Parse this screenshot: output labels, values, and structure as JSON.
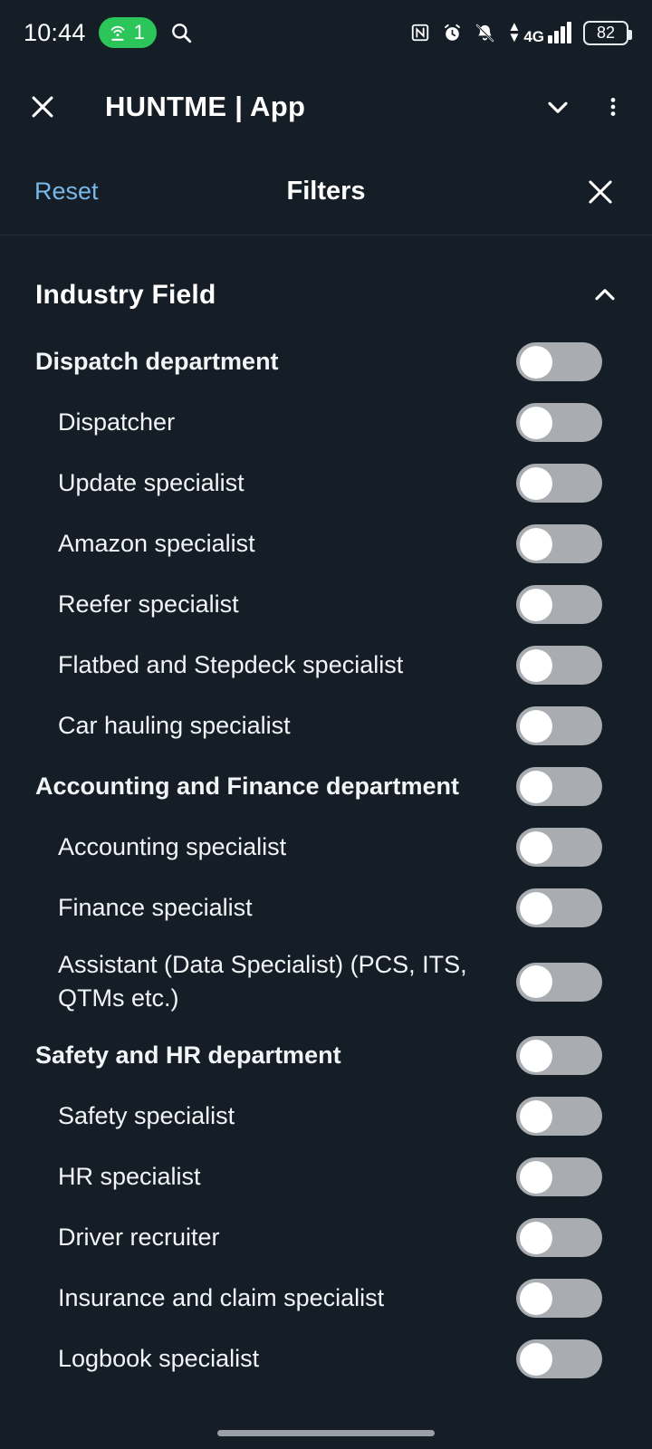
{
  "statusbar": {
    "time": "10:44",
    "hotspot_count": "1",
    "battery_percent": "82",
    "network_label": "4G",
    "icons": [
      "search-icon",
      "nfc-icon",
      "alarm-icon",
      "notifications-muted-icon",
      "signal-icon",
      "battery-icon"
    ]
  },
  "appbar": {
    "title": "HUNTME | App",
    "close_label": "close-icon",
    "expand_label": "chevron-down-icon",
    "overflow_label": "more-vertical-icon"
  },
  "filterbar": {
    "reset_label": "Reset",
    "title": "Filters",
    "close_label": "close-icon"
  },
  "section": {
    "title": "Industry Field",
    "expanded": true,
    "collapse_icon": "chevron-up-icon"
  },
  "colors": {
    "background": "#151d26",
    "accent_link": "#79b8e8",
    "toggle_off_track": "#a9adb1",
    "toggle_knob": "#ffffff",
    "hotspot_green": "#2bc55a",
    "text_primary": "#f2f5f7"
  },
  "rows": [
    {
      "label": "Dispatch department",
      "type": "dept",
      "on": false
    },
    {
      "label": "Dispatcher",
      "type": "child",
      "on": false
    },
    {
      "label": "Update specialist",
      "type": "child",
      "on": false
    },
    {
      "label": "Amazon specialist",
      "type": "child",
      "on": false
    },
    {
      "label": "Reefer specialist",
      "type": "child",
      "on": false
    },
    {
      "label": "Flatbed and Stepdeck specialist",
      "type": "child",
      "on": false
    },
    {
      "label": "Car hauling specialist",
      "type": "child",
      "on": false
    },
    {
      "label": "Accounting and Finance department",
      "type": "dept",
      "on": false
    },
    {
      "label": "Accounting specialist",
      "type": "child",
      "on": false
    },
    {
      "label": "Finance specialist",
      "type": "child",
      "on": false
    },
    {
      "label": "Assistant (Data Specialist) (PCS, ITS, QTMs etc.)",
      "type": "child",
      "on": false,
      "tall": true
    },
    {
      "label": "Safety and HR department",
      "type": "dept",
      "on": false
    },
    {
      "label": "Safety specialist",
      "type": "child",
      "on": false
    },
    {
      "label": "HR specialist",
      "type": "child",
      "on": false
    },
    {
      "label": "Driver recruiter",
      "type": "child",
      "on": false
    },
    {
      "label": "Insurance and claim specialist",
      "type": "child",
      "on": false
    },
    {
      "label": "Logbook specialist",
      "type": "child",
      "on": false
    }
  ]
}
